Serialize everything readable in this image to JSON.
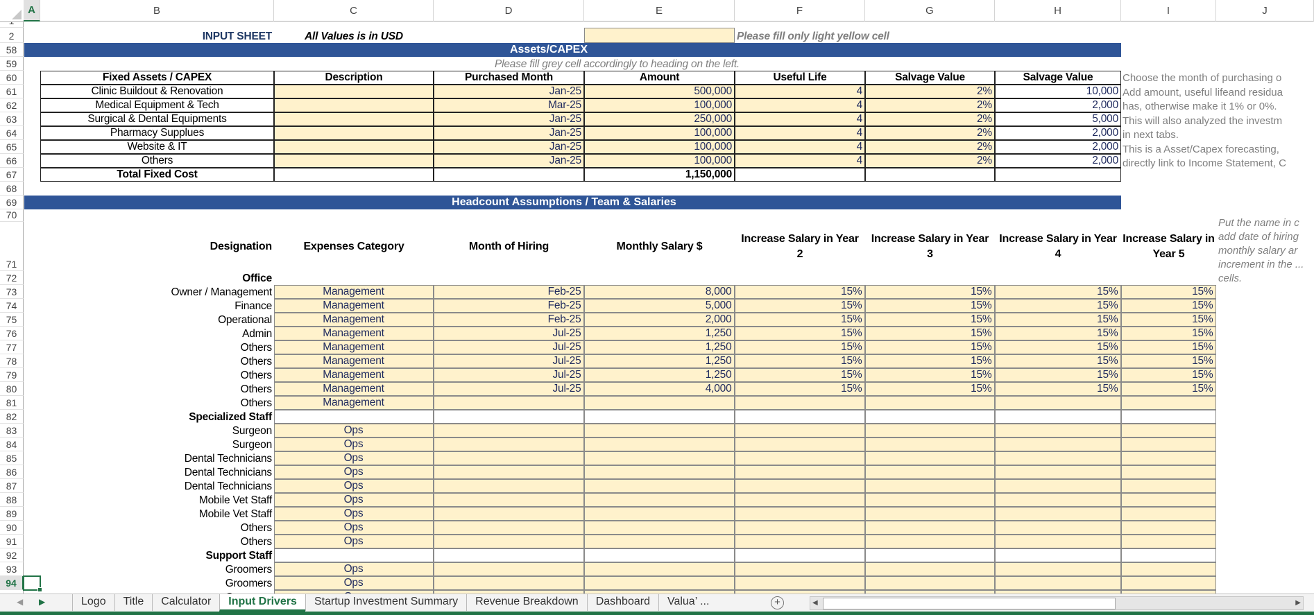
{
  "columns": [
    "A",
    "B",
    "C",
    "D",
    "E",
    "F",
    "G",
    "H",
    "I",
    "J"
  ],
  "selected_cell": "A94",
  "header": {
    "title": "INPUT SHEET",
    "units_note": "All Values is in USD",
    "fill_note": "Please fill only light yellow cell"
  },
  "capex": {
    "band_title": "Assets/CAPEX",
    "note": "Please fill grey cell accordingly to heading on the left.",
    "headers": [
      "Fixed Assets / CAPEX",
      "Description",
      "Purchased  Month",
      "Amount",
      "Useful Life",
      "Salvage Value",
      "Salvage Value"
    ],
    "rows": [
      {
        "name": "Clinic Buildout & Renovation",
        "description": "",
        "month": "Jan-25",
        "amount": "500,000",
        "life": "4",
        "salvage_pct": "2%",
        "salvage_value": "10,000"
      },
      {
        "name": "Medical Equipment & Tech",
        "description": "",
        "month": "Mar-25",
        "amount": "100,000",
        "life": "4",
        "salvage_pct": "2%",
        "salvage_value": "2,000"
      },
      {
        "name": "Surgical & Dental Equipments",
        "description": "",
        "month": "Jan-25",
        "amount": "250,000",
        "life": "4",
        "salvage_pct": "2%",
        "salvage_value": "5,000"
      },
      {
        "name": "Pharmacy Supplues",
        "description": "",
        "month": "Jan-25",
        "amount": "100,000",
        "life": "4",
        "salvage_pct": "2%",
        "salvage_value": "2,000"
      },
      {
        "name": "Website & IT",
        "description": "",
        "month": "Jan-25",
        "amount": "100,000",
        "life": "4",
        "salvage_pct": "2%",
        "salvage_value": "2,000"
      },
      {
        "name": "Others",
        "description": "",
        "month": "Jan-25",
        "amount": "100,000",
        "life": "4",
        "salvage_pct": "2%",
        "salvage_value": "2,000"
      }
    ],
    "total_label": "Total Fixed Cost",
    "total_amount": "1,150,000",
    "side_notes": [
      "Choose the month of purchasing o",
      "Add amount, useful lifeand residua",
      "has, otherwise make it 1% or 0%.",
      "This will also analyzed the investm",
      "in next tabs.",
      "This is a Asset/Capex forecasting,",
      "directly link to Income Statement, C"
    ]
  },
  "headcount": {
    "band_title": "Headcount Assumptions / Team & Salaries",
    "headers": [
      "Designation",
      "Expenses Category",
      "Month of Hiring",
      "Monthly Salary $",
      "Increase Salary in Year 2",
      "Increase Salary in Year 3",
      "Increase Salary in Year 4",
      "Increase Salary in Year 5"
    ],
    "side_notes": [
      "Put the name in c",
      "add date of hiring",
      "monthly salary ar",
      "increment in the ...",
      "cells."
    ],
    "groups": [
      {
        "name": "Office",
        "rows": [
          {
            "designation": "Owner / Management",
            "category": "Management",
            "month": "Feb-25",
            "salary": "8,000",
            "y2": "15%",
            "y3": "15%",
            "y4": "15%",
            "y5": "15%"
          },
          {
            "designation": "Finance",
            "category": "Management",
            "month": "Feb-25",
            "salary": "5,000",
            "y2": "15%",
            "y3": "15%",
            "y4": "15%",
            "y5": "15%"
          },
          {
            "designation": "Operational",
            "category": "Management",
            "month": "Feb-25",
            "salary": "2,000",
            "y2": "15%",
            "y3": "15%",
            "y4": "15%",
            "y5": "15%"
          },
          {
            "designation": "Admin",
            "category": "Management",
            "month": "Jul-25",
            "salary": "1,250",
            "y2": "15%",
            "y3": "15%",
            "y4": "15%",
            "y5": "15%"
          },
          {
            "designation": "Others",
            "category": "Management",
            "month": "Jul-25",
            "salary": "1,250",
            "y2": "15%",
            "y3": "15%",
            "y4": "15%",
            "y5": "15%"
          },
          {
            "designation": "Others",
            "category": "Management",
            "month": "Jul-25",
            "salary": "1,250",
            "y2": "15%",
            "y3": "15%",
            "y4": "15%",
            "y5": "15%"
          },
          {
            "designation": "Others",
            "category": "Management",
            "month": "Jul-25",
            "salary": "1,250",
            "y2": "15%",
            "y3": "15%",
            "y4": "15%",
            "y5": "15%"
          },
          {
            "designation": "Others",
            "category": "Management",
            "month": "Jul-25",
            "salary": "4,000",
            "y2": "15%",
            "y3": "15%",
            "y4": "15%",
            "y5": "15%"
          },
          {
            "designation": "Others",
            "category": "Management",
            "month": "",
            "salary": "",
            "y2": "",
            "y3": "",
            "y4": "",
            "y5": ""
          }
        ]
      },
      {
        "name": "Specialized Staff",
        "rows": [
          {
            "designation": "Surgeon",
            "category": "Ops",
            "month": "",
            "salary": "",
            "y2": "",
            "y3": "",
            "y4": "",
            "y5": ""
          },
          {
            "designation": "Surgeon",
            "category": "Ops",
            "month": "",
            "salary": "",
            "y2": "",
            "y3": "",
            "y4": "",
            "y5": ""
          },
          {
            "designation": "Dental Technicians",
            "category": "Ops",
            "month": "",
            "salary": "",
            "y2": "",
            "y3": "",
            "y4": "",
            "y5": ""
          },
          {
            "designation": "Dental Technicians",
            "category": "Ops",
            "month": "",
            "salary": "",
            "y2": "",
            "y3": "",
            "y4": "",
            "y5": ""
          },
          {
            "designation": "Dental Technicians",
            "category": "Ops",
            "month": "",
            "salary": "",
            "y2": "",
            "y3": "",
            "y4": "",
            "y5": ""
          },
          {
            "designation": "Mobile Vet Staff",
            "category": "Ops",
            "month": "",
            "salary": "",
            "y2": "",
            "y3": "",
            "y4": "",
            "y5": ""
          },
          {
            "designation": "Mobile Vet Staff",
            "category": "Ops",
            "month": "",
            "salary": "",
            "y2": "",
            "y3": "",
            "y4": "",
            "y5": ""
          },
          {
            "designation": "Others",
            "category": "Ops",
            "month": "",
            "salary": "",
            "y2": "",
            "y3": "",
            "y4": "",
            "y5": ""
          },
          {
            "designation": "Others",
            "category": "Ops",
            "month": "",
            "salary": "",
            "y2": "",
            "y3": "",
            "y4": "",
            "y5": ""
          }
        ]
      },
      {
        "name": "Support Staff",
        "rows": [
          {
            "designation": "Groomers",
            "category": "Ops",
            "month": "",
            "salary": "",
            "y2": "",
            "y3": "",
            "y4": "",
            "y5": ""
          },
          {
            "designation": "Groomers",
            "category": "Ops",
            "month": "",
            "salary": "",
            "y2": "",
            "y3": "",
            "y4": "",
            "y5": ""
          },
          {
            "designation": "Groomers",
            "category": "Ops",
            "month": "",
            "salary": "",
            "y2": "",
            "y3": "",
            "y4": "",
            "y5": ""
          }
        ]
      }
    ]
  },
  "tabs": [
    {
      "label": "Logo"
    },
    {
      "label": "Title"
    },
    {
      "label": "Calculator"
    },
    {
      "label": "Input Drivers",
      "active": true
    },
    {
      "label": "Startup Investment Summary"
    },
    {
      "label": "Revenue Breakdown"
    },
    {
      "label": "Dashboard"
    },
    {
      "label": "Valua’ ..."
    }
  ],
  "tab_add_label": "+"
}
